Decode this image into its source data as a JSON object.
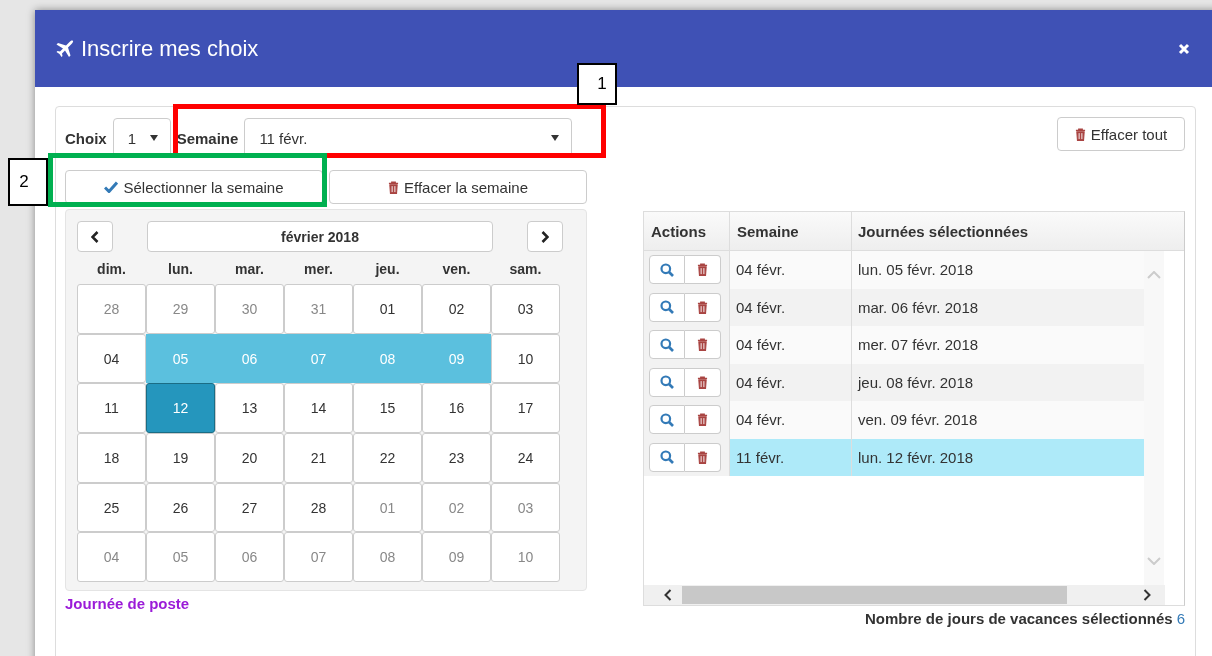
{
  "dialog": {
    "title": "Inscrire mes choix"
  },
  "choice": {
    "label": "Choix",
    "value": "1"
  },
  "week": {
    "label": "Semaine",
    "value": "11 févr."
  },
  "clear_all_button": "Effacer tout",
  "select_week_button": "Sélectionner la semaine",
  "clear_week_button": "Effacer la semaine",
  "calendar": {
    "month": "février 2018",
    "weekdays": [
      "dim.",
      "lun.",
      "mar.",
      "mer.",
      "jeu.",
      "ven.",
      "sam."
    ],
    "weeks": [
      [
        {
          "day": "28",
          "kind": "other"
        },
        {
          "day": "29",
          "kind": "other"
        },
        {
          "day": "30",
          "kind": "other"
        },
        {
          "day": "31",
          "kind": "other"
        },
        {
          "day": "01",
          "kind": "normal"
        },
        {
          "day": "02",
          "kind": "normal"
        },
        {
          "day": "03",
          "kind": "normal"
        }
      ],
      [
        {
          "day": "04",
          "kind": "normal"
        },
        {
          "day": "05",
          "kind": "range"
        },
        {
          "day": "06",
          "kind": "range"
        },
        {
          "day": "07",
          "kind": "range"
        },
        {
          "day": "08",
          "kind": "range"
        },
        {
          "day": "09",
          "kind": "range"
        },
        {
          "day": "10",
          "kind": "normal"
        }
      ],
      [
        {
          "day": "11",
          "kind": "normal"
        },
        {
          "day": "12",
          "kind": "active"
        },
        {
          "day": "13",
          "kind": "normal"
        },
        {
          "day": "14",
          "kind": "normal"
        },
        {
          "day": "15",
          "kind": "normal"
        },
        {
          "day": "16",
          "kind": "normal"
        },
        {
          "day": "17",
          "kind": "normal"
        }
      ],
      [
        {
          "day": "18",
          "kind": "normal"
        },
        {
          "day": "19",
          "kind": "normal"
        },
        {
          "day": "20",
          "kind": "normal"
        },
        {
          "day": "21",
          "kind": "normal"
        },
        {
          "day": "22",
          "kind": "normal"
        },
        {
          "day": "23",
          "kind": "normal"
        },
        {
          "day": "24",
          "kind": "normal"
        }
      ],
      [
        {
          "day": "25",
          "kind": "normal"
        },
        {
          "day": "26",
          "kind": "normal"
        },
        {
          "day": "27",
          "kind": "normal"
        },
        {
          "day": "28",
          "kind": "normal"
        },
        {
          "day": "01",
          "kind": "other"
        },
        {
          "day": "02",
          "kind": "other"
        },
        {
          "day": "03",
          "kind": "other"
        }
      ],
      [
        {
          "day": "04",
          "kind": "other"
        },
        {
          "day": "05",
          "kind": "other"
        },
        {
          "day": "06",
          "kind": "other"
        },
        {
          "day": "07",
          "kind": "other"
        },
        {
          "day": "08",
          "kind": "other"
        },
        {
          "day": "09",
          "kind": "other"
        },
        {
          "day": "10",
          "kind": "other"
        }
      ]
    ]
  },
  "legend": "Journée de poste",
  "table": {
    "columns": [
      "Actions",
      "Semaine",
      "Journées sélectionnées"
    ],
    "rows": [
      {
        "week": "04 févr.",
        "day": "lun. 05 févr. 2018",
        "selected": false
      },
      {
        "week": "04 févr.",
        "day": "mar. 06 févr. 2018",
        "selected": false
      },
      {
        "week": "04 févr.",
        "day": "mer. 07 févr. 2018",
        "selected": false
      },
      {
        "week": "04 févr.",
        "day": "jeu. 08 févr. 2018",
        "selected": false
      },
      {
        "week": "04 févr.",
        "day": "ven. 09 févr. 2018",
        "selected": false
      },
      {
        "week": "11 févr.",
        "day": "lun. 12 févr. 2018",
        "selected": true
      }
    ]
  },
  "total": {
    "label": "Nombre de jours de vacances sélectionnés",
    "value": "6"
  },
  "annotations": [
    {
      "label": "1",
      "color": "#ff0000"
    },
    {
      "label": "2",
      "color": "#00b050"
    }
  ]
}
